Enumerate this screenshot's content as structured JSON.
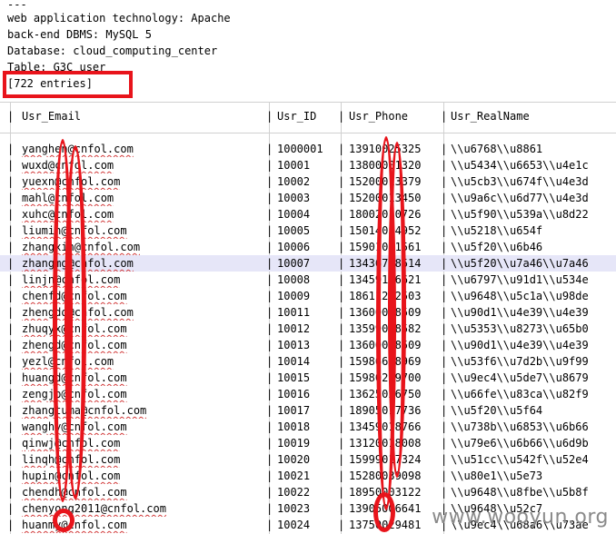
{
  "header_lines": [
    "---",
    "web application technology: Apache",
    "back-end DBMS: MySQL 5",
    "Database: cloud_computing_center",
    "Table: G3C_user",
    "[722 entries]"
  ],
  "table": {
    "columns": [
      "Usr_Email",
      "Usr_ID",
      "Usr_Phone",
      "Usr_RealName"
    ],
    "rows": [
      [
        "yanghen@cnfol.com",
        "1000001",
        "13910025325",
        "\\\\u6768\\\\u8861"
      ],
      [
        "wuxd@cnfol.com",
        "10001",
        "13800001320",
        "\\\\u5434\\\\u6653\\\\u4e1c"
      ],
      [
        "yuexn@cnfol.com",
        "10002",
        "15200013379",
        "\\\\u5cb3\\\\u674f\\\\u4e3d"
      ],
      [
        "mahl@cnfol.com",
        "10003",
        "15200013450",
        "\\\\u9a6c\\\\u6d77\\\\u4e3d"
      ],
      [
        "xuhc@cnfol.com",
        "10004",
        "18002010726",
        "\\\\u5f90\\\\u539a\\\\u8d22"
      ],
      [
        "liumin@cnfol.com",
        "10005",
        "15014054952",
        "\\\\u5218\\\\u654f"
      ],
      [
        "zhangxin@cnfol.com",
        "10006",
        "15901061561",
        "\\\\u5f20\\\\u6b46"
      ],
      [
        "zhangmg@cnfol.com",
        "10007",
        "13436718514",
        "\\\\u5f20\\\\u7a46\\\\u7a46"
      ],
      [
        "linjn@cnfol.com",
        "10008",
        "13459106621",
        "\\\\u6797\\\\u91d1\\\\u534e"
      ],
      [
        "chenfd@cnfol.com",
        "10009",
        "18611282503",
        "\\\\u9648\\\\u5c1a\\\\u98de"
      ],
      [
        "zhengdq@cnfol.com",
        "10011",
        "13600018509",
        "\\\\u90d1\\\\u4e39\\\\u4e39"
      ],
      [
        "zhuqyx@cnfol.com",
        "10012",
        "13599008582",
        "\\\\u5353\\\\u8273\\\\u65b0"
      ],
      [
        "zhengd@cnfol.com",
        "10013",
        "13600018509",
        "\\\\u90d1\\\\u4e39\\\\u4e39"
      ],
      [
        "yezl@cnfol.com",
        "10014",
        "15986638969",
        "\\\\u53f6\\\\u7d2b\\\\u9f99"
      ],
      [
        "huangd@cnfol.com",
        "10015",
        "15980249700",
        "\\\\u9ec4\\\\u5de7\\\\u8679"
      ],
      [
        "zengjp@cnfol.com",
        "10016",
        "13625026750",
        "\\\\u66fe\\\\u83ca\\\\u82f9"
      ],
      [
        "zhangtuma@cnfol.com",
        "10017",
        "18905017736",
        "\\\\u5f20\\\\u5f64"
      ],
      [
        "wanghy@cnfol.com",
        "10018",
        "13459018766",
        "\\\\u738b\\\\u6853\\\\u6b66"
      ],
      [
        "qinwj@cnfol.com",
        "10019",
        "13120018008",
        "\\\\u79e6\\\\u6b66\\\\u6d9b"
      ],
      [
        "linqh@cnfol.com",
        "10020",
        "15999017324",
        "\\\\u51cc\\\\u542f\\\\u52e4"
      ],
      [
        "hupin@cnfol.com",
        "10021",
        "15280039098",
        "\\\\u80e1\\\\u5e73"
      ],
      [
        "chendh@cnfol.com",
        "10022",
        "18950003122",
        "\\\\u9648\\\\u8fbe\\\\u5b8f"
      ],
      [
        "chenyong2011@cnfol.com",
        "10023",
        "13905006641",
        "\\\\u9648\\\\u52c7"
      ],
      [
        "huanmy@cnfol.com",
        "10024",
        "13750029481",
        "\\\\u9ec4\\\\u68a6\\\\u73ae"
      ]
    ]
  },
  "watermark": "www.wooyun.org",
  "colors": {
    "annotation": "#e8141b",
    "highlight_row": "#e6e6f8",
    "grid": "#d0d0d0"
  }
}
